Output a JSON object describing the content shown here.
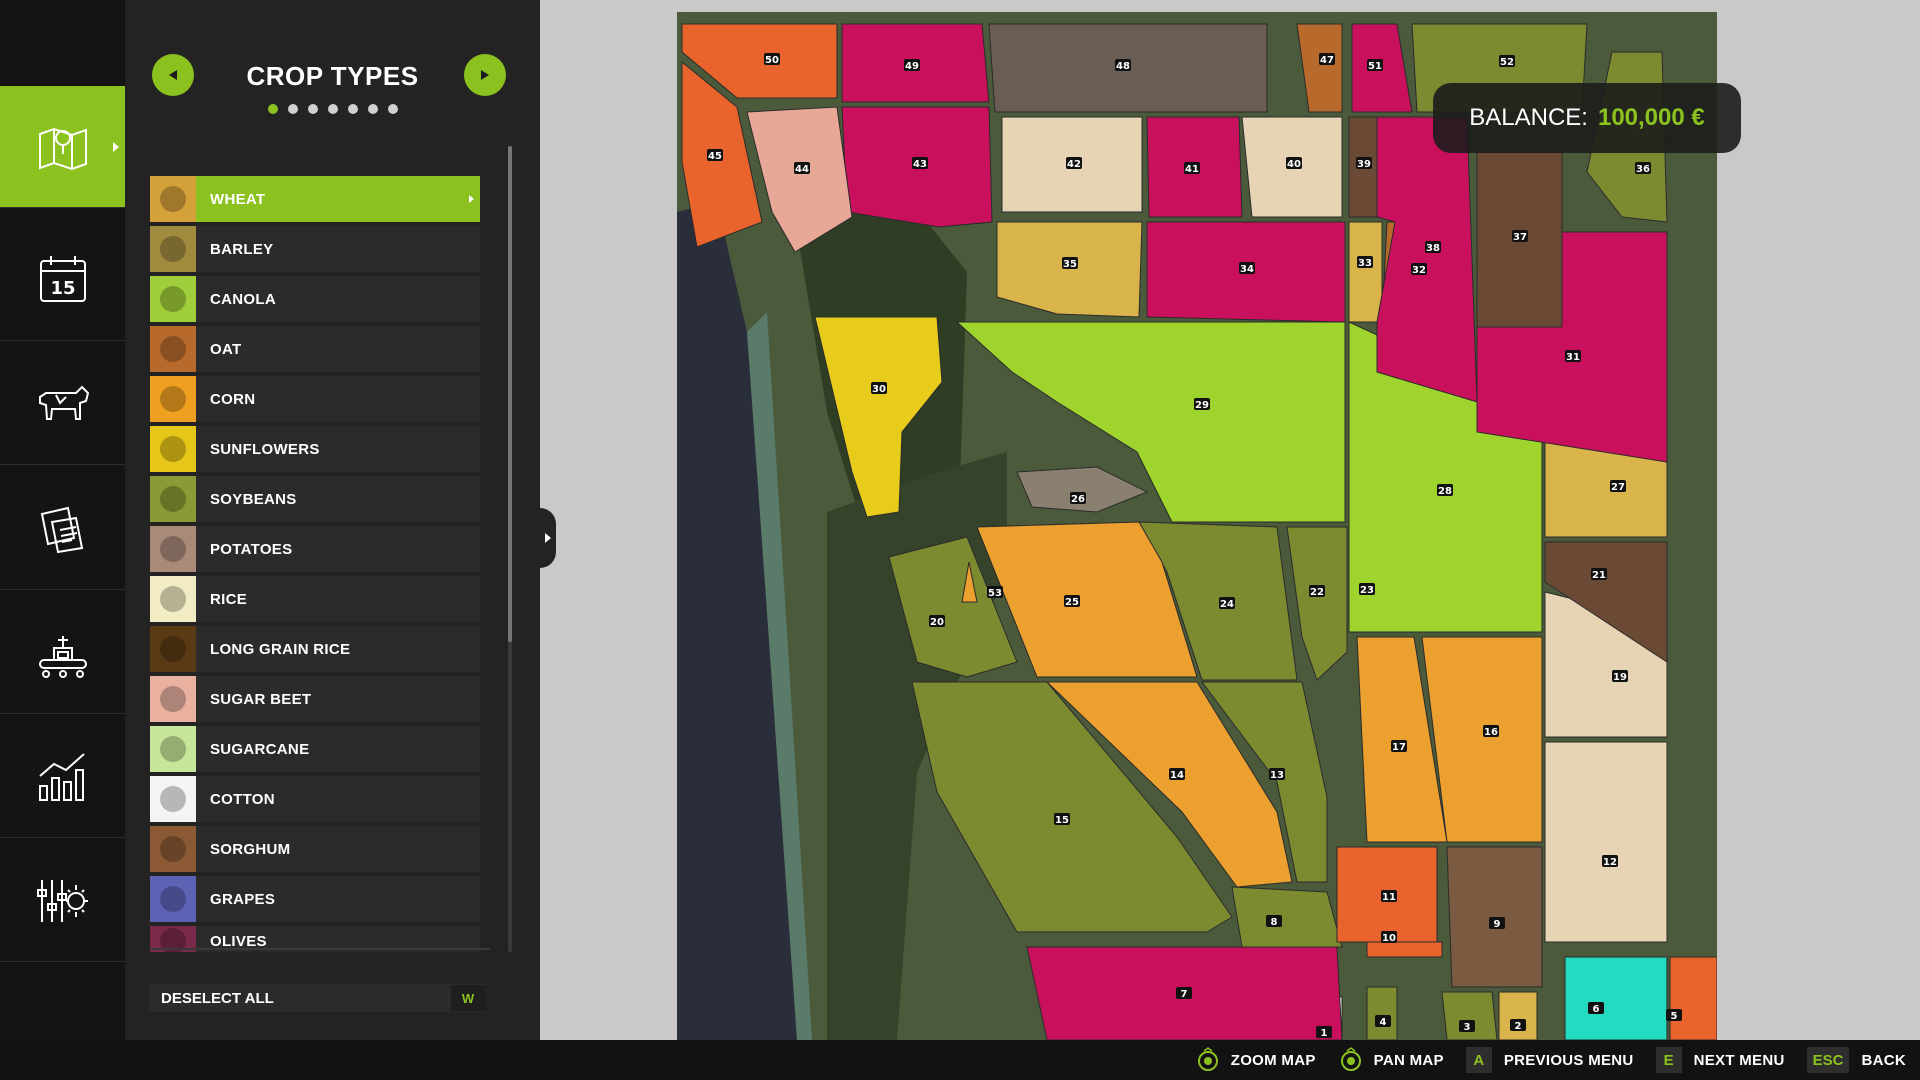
{
  "colors": {
    "accent": "#8cc21f"
  },
  "rail": {
    "items": [
      {
        "name": "map",
        "icon": "map-icon",
        "active": true
      },
      {
        "name": "calendar",
        "icon": "calendar-icon",
        "active": false,
        "day": "15"
      },
      {
        "name": "animals",
        "icon": "cow-icon",
        "active": false
      },
      {
        "name": "contracts",
        "icon": "contracts-icon",
        "active": false
      },
      {
        "name": "production",
        "icon": "production-icon",
        "active": false
      },
      {
        "name": "statistics",
        "icon": "chart-icon",
        "active": false
      },
      {
        "name": "settings",
        "icon": "settings-gear-icon",
        "active": false
      }
    ]
  },
  "panel": {
    "title": "CROP TYPES",
    "page_count": 7,
    "active_page": 0,
    "crops": [
      {
        "label": "WHEAT",
        "icon": "wheat-icon",
        "color": "#d4a13a",
        "selected": true
      },
      {
        "label": "BARLEY",
        "icon": "barley-icon",
        "color": "#a08a3e"
      },
      {
        "label": "CANOLA",
        "icon": "canola-icon",
        "color": "#9fce3a"
      },
      {
        "label": "OAT",
        "icon": "oat-icon",
        "color": "#b86a2c"
      },
      {
        "label": "CORN",
        "icon": "corn-icon",
        "color": "#f0a020"
      },
      {
        "label": "SUNFLOWERS",
        "icon": "sunflower-icon",
        "color": "#e6c619"
      },
      {
        "label": "SOYBEANS",
        "icon": "soybean-icon",
        "color": "#8a9a34"
      },
      {
        "label": "POTATOES",
        "icon": "potato-icon",
        "color": "#a98a78"
      },
      {
        "label": "RICE",
        "icon": "rice-icon",
        "color": "#f2ecc4"
      },
      {
        "label": "LONG GRAIN RICE",
        "icon": "long-grain-rice-icon",
        "color": "#5a3a14"
      },
      {
        "label": "SUGAR BEET",
        "icon": "sugar-beet-icon",
        "color": "#eab0a0"
      },
      {
        "label": "SUGARCANE",
        "icon": "sugarcane-icon",
        "color": "#c8e69a"
      },
      {
        "label": "COTTON",
        "icon": "cotton-icon",
        "color": "#f4f4f4"
      },
      {
        "label": "SORGHUM",
        "icon": "sorghum-icon",
        "color": "#8b5a34"
      },
      {
        "label": "GRAPES",
        "icon": "grapes-icon",
        "color": "#5e62b4"
      },
      {
        "label": "OLIVES",
        "icon": "olive-icon",
        "color": "#7a2a4a"
      }
    ],
    "deselect_label": "DESELECT ALL",
    "deselect_key": "W"
  },
  "balance": {
    "label": "BALANCE:",
    "amount": "100,000 €"
  },
  "map": {
    "fields": [
      {
        "id": "1",
        "color": "#f2f2f2"
      },
      {
        "id": "2",
        "color": "#d8b44a"
      },
      {
        "id": "3",
        "color": "#7c8a30"
      },
      {
        "id": "4",
        "color": "#7c8a30"
      },
      {
        "id": "5",
        "color": "#e8642c"
      },
      {
        "id": "6",
        "color": "#22dbc0"
      },
      {
        "id": "7",
        "color": "#c8105c"
      },
      {
        "id": "8",
        "color": "#7c8a30"
      },
      {
        "id": "9",
        "color": "#7a5a40"
      },
      {
        "id": "10",
        "color": "#e8642c"
      },
      {
        "id": "11",
        "color": "#e8642c"
      },
      {
        "id": "12",
        "color": "#e6d4b4"
      },
      {
        "id": "13",
        "color": "#7c8a30"
      },
      {
        "id": "14",
        "color": "#eca030"
      },
      {
        "id": "15",
        "color": "#7c8a30"
      },
      {
        "id": "16",
        "color": "#eca030"
      },
      {
        "id": "17",
        "color": "#eca030"
      },
      {
        "id": "19",
        "color": "#e6d4b4"
      },
      {
        "id": "20",
        "color": "#7c8a30"
      },
      {
        "id": "21",
        "color": "#6a4a34"
      },
      {
        "id": "22",
        "color": "#7c8a30"
      },
      {
        "id": "23",
        "color": "#9fd42e"
      },
      {
        "id": "24",
        "color": "#7c8a30"
      },
      {
        "id": "25",
        "color": "#eca030"
      },
      {
        "id": "26",
        "color": "#8a8070"
      },
      {
        "id": "27",
        "color": "#d8b44a"
      },
      {
        "id": "28",
        "color": "#9fd42e"
      },
      {
        "id": "29",
        "color": "#9fd42e"
      },
      {
        "id": "30",
        "color": "#e8cc1c"
      },
      {
        "id": "31",
        "color": "#c8105c"
      },
      {
        "id": "32",
        "color": "#b86a2c"
      },
      {
        "id": "33",
        "color": "#d8b44a"
      },
      {
        "id": "34",
        "color": "#c8105c"
      },
      {
        "id": "35",
        "color": "#d8b44a"
      },
      {
        "id": "36",
        "color": "#7c8a30"
      },
      {
        "id": "37",
        "color": "#6a4a34"
      },
      {
        "id": "38",
        "color": "#c8105c"
      },
      {
        "id": "39",
        "color": "#6a4a34"
      },
      {
        "id": "40",
        "color": "#e6d4b4"
      },
      {
        "id": "41",
        "color": "#c8105c"
      },
      {
        "id": "42",
        "color": "#e6d4b4"
      },
      {
        "id": "43",
        "color": "#c8105c"
      },
      {
        "id": "44",
        "color": "#e8a898"
      },
      {
        "id": "45",
        "color": "#e8642c"
      },
      {
        "id": "47",
        "color": "#b86a2c"
      },
      {
        "id": "48",
        "color": "#6a5e54"
      },
      {
        "id": "49",
        "color": "#c8105c"
      },
      {
        "id": "50",
        "color": "#e8642c"
      },
      {
        "id": "51",
        "color": "#c8105c"
      },
      {
        "id": "52",
        "color": "#7c8a30"
      },
      {
        "id": "53",
        "color": "#eca030"
      }
    ]
  },
  "bottombar": {
    "hints": [
      {
        "key": "",
        "icon": "stick-icon",
        "label": "ZOOM MAP"
      },
      {
        "key": "",
        "icon": "stick-icon",
        "label": "PAN MAP"
      },
      {
        "key": "A",
        "label": "PREVIOUS MENU"
      },
      {
        "key": "E",
        "label": "NEXT MENU"
      },
      {
        "key": "ESC",
        "label": "BACK"
      }
    ]
  }
}
